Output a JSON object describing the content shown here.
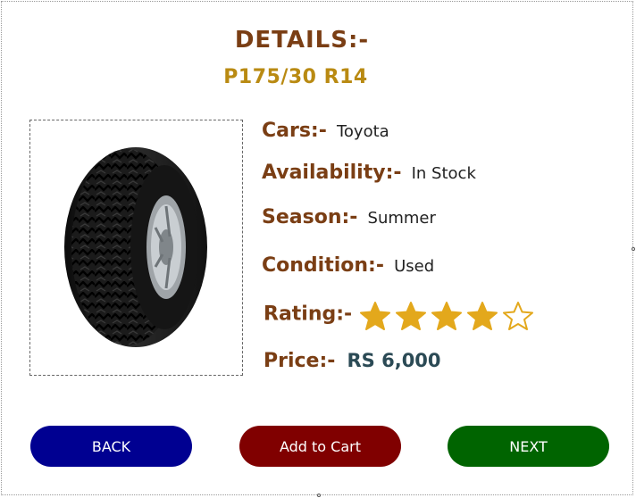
{
  "header": {
    "title": "DETAILS:-",
    "tire_size": "P175/30 R14"
  },
  "product_image": {
    "icon": "tire-icon"
  },
  "details": {
    "cars_label": "Cars:-",
    "cars_value": "Toyota",
    "availability_label": "Availability:-",
    "availability_value": "In Stock",
    "season_label": "Season:-",
    "season_value": "Summer",
    "condition_label": "Condition:-",
    "condition_value": "Used",
    "rating_label": "Rating:-",
    "rating_value": 4,
    "rating_max": 5,
    "price_label": "Price:-",
    "price_value": "RS 6,000"
  },
  "buttons": {
    "back_label": "BACK",
    "cart_label": "Add to Cart",
    "next_label": "NEXT"
  },
  "colors": {
    "label_brown": "#7a3e14",
    "size_gold": "#b98a12",
    "star_gold": "#e3a81c",
    "back_blue": "#000091",
    "cart_maroon": "#800000",
    "next_green": "#006400"
  }
}
